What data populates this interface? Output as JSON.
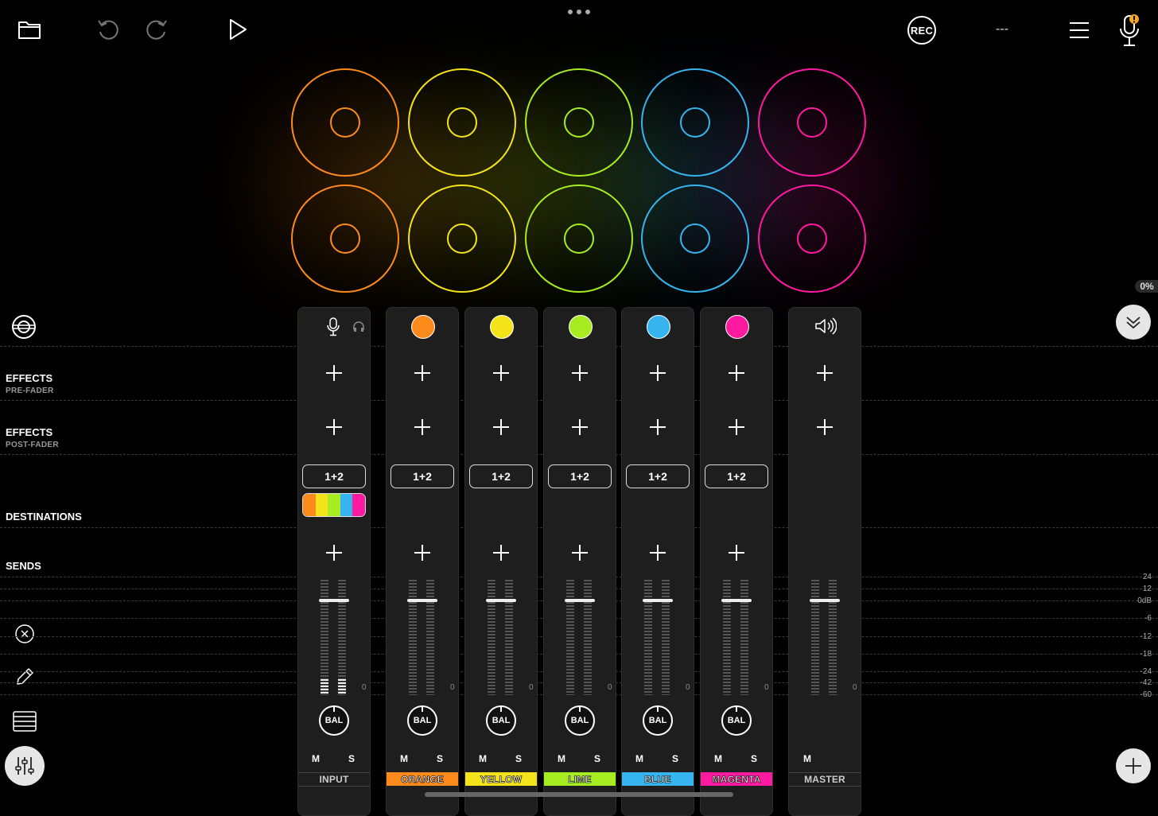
{
  "toolbar": {
    "rec_label": "REC",
    "tempo_display": "---"
  },
  "status": {
    "load_percent": "0%"
  },
  "pads": {
    "colors": [
      "#ff8a1c",
      "#f5e31a",
      "#a6ec20",
      "#35b4f0",
      "#ff1aa0"
    ]
  },
  "rows": {
    "effects_pre": "EFFECTS",
    "effects_pre_sub": "PRE-FADER",
    "effects_post": "EFFECTS",
    "effects_post_sub": "POST-FADER",
    "destinations": "DESTINATIONS",
    "sends": "SENDS"
  },
  "channels": [
    {
      "name": "INPUT",
      "dest": "1+2",
      "m": "M",
      "s": "S",
      "bal": "BAL",
      "zero": "0"
    },
    {
      "name": "ORANGE",
      "dest": "1+2",
      "m": "M",
      "s": "S",
      "bal": "BAL",
      "zero": "0",
      "color": "#ff8a1c"
    },
    {
      "name": "YELLOW",
      "dest": "1+2",
      "m": "M",
      "s": "S",
      "bal": "BAL",
      "zero": "0",
      "color": "#f5e31a"
    },
    {
      "name": "LIME",
      "dest": "1+2",
      "m": "M",
      "s": "S",
      "bal": "BAL",
      "zero": "0",
      "color": "#a6ec20"
    },
    {
      "name": "BLUE",
      "dest": "1+2",
      "m": "M",
      "s": "S",
      "bal": "BAL",
      "zero": "0",
      "color": "#35b4f0"
    },
    {
      "name": "MAGENTA",
      "dest": "1+2",
      "m": "M",
      "s": "S",
      "bal": "BAL",
      "zero": "0",
      "color": "#ff1aa0"
    },
    {
      "name": "MASTER",
      "m": "M",
      "zero": "0"
    }
  ],
  "db_scale": [
    "24",
    "12",
    "0dB",
    "-6",
    "-12",
    "-18",
    "-24",
    "-42",
    "-60"
  ],
  "icons": {
    "files": "folder-icon",
    "undo": "undo-icon",
    "redo": "redo-icon",
    "play": "play-icon",
    "menu": "hamburger-icon",
    "mic": "microphone-icon",
    "loops": "disc-icon",
    "delete": "close-circle-icon",
    "edit": "pencil-icon",
    "tracks": "list-icon",
    "mixer": "sliders-icon",
    "speaker": "speaker-icon"
  }
}
